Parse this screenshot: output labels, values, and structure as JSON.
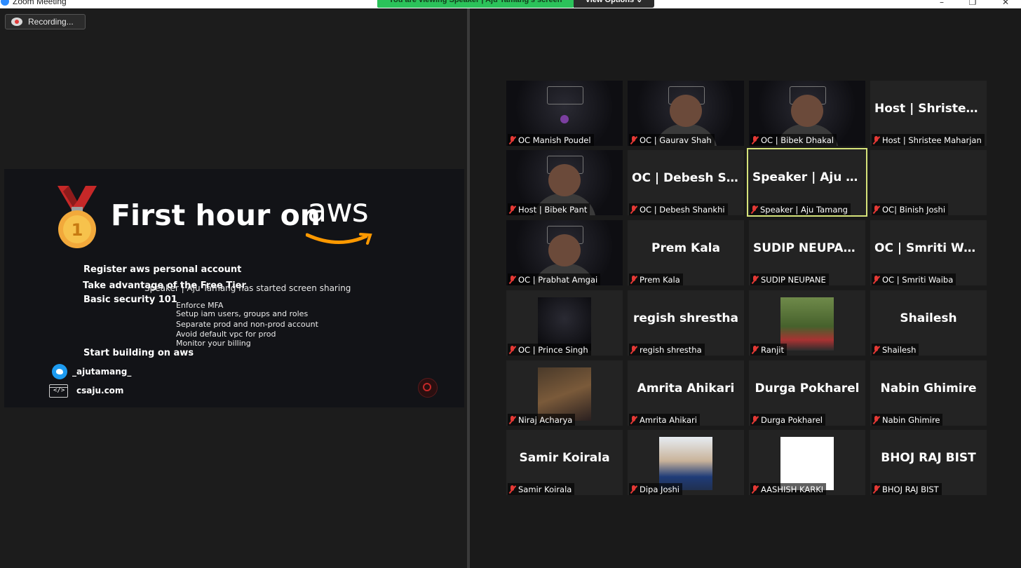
{
  "window": {
    "title": "Zoom Meeting",
    "viewing_banner": "You are viewing Speaker | Aju Tamang's screen",
    "view_options": "View Options ⌄",
    "controls": [
      "–",
      "❐",
      "✕"
    ]
  },
  "recording": {
    "label": "Recording..."
  },
  "slide": {
    "title": "First hour on",
    "brand": "aws",
    "bullets": [
      "Register aws personal account",
      "Take advantage of the Free Tier",
      "Basic security 101"
    ],
    "security_items": [
      "Enforce MFA",
      "Setup iam users, groups and roles",
      "Separate prod and non-prod account",
      "Avoid default vpc for prod",
      "Monitor your billing"
    ],
    "final_bullet": "Start building on aws",
    "twitter_handle": "_ajutamang_",
    "website": "csaju.com",
    "share_notice": "Speaker | Aju Tamang has started screen sharing",
    "medal_number": "1"
  },
  "participants": [
    {
      "label": "OC Manish Poudel",
      "name": "",
      "video": "event"
    },
    {
      "label": "OC | Gaurav Shah",
      "name": "",
      "video": "person"
    },
    {
      "label": "OC | Bibek Dhakal",
      "name": "",
      "video": "person"
    },
    {
      "label": "Host | Shristee Maharjan",
      "name": "Host | Shristee...",
      "video": "none"
    },
    {
      "label": "Host | Bibek Pant",
      "name": "",
      "video": "person"
    },
    {
      "label": "OC | Debesh Shankhi",
      "name": "OC | Debesh Sh...",
      "video": "none"
    },
    {
      "label": "Speaker | Aju Tamang",
      "name": "Speaker | Aju Ta...",
      "video": "none",
      "active": true
    },
    {
      "label": "OC| Binish Joshi",
      "name": "",
      "video": "none"
    },
    {
      "label": "OC | Prabhat Amgai",
      "name": "",
      "video": "person"
    },
    {
      "label": "Prem Kala",
      "name": "Prem Kala",
      "video": "none"
    },
    {
      "label": "SUDIP NEUPANE",
      "name": "SUDIP NEUPANE",
      "video": "none"
    },
    {
      "label": "OC | Smriti Waiba",
      "name": "OC | Smriti Waiba",
      "video": "none"
    },
    {
      "label": "OC | Prince Singh",
      "name": "",
      "video": "event-small"
    },
    {
      "label": "regish shrestha",
      "name": "regish shrestha",
      "video": "none"
    },
    {
      "label": "Ranjit",
      "name": "",
      "video": "photo-green"
    },
    {
      "label": "Shailesh",
      "name": "Shailesh",
      "video": "none"
    },
    {
      "label": "Niraj Acharya",
      "name": "",
      "video": "photo-brown"
    },
    {
      "label": "Amrita Ahikari",
      "name": "Amrita Ahikari",
      "video": "none"
    },
    {
      "label": "Durga Pokharel",
      "name": "Durga Pokharel",
      "video": "none"
    },
    {
      "label": "Nabin Ghimire",
      "name": "Nabin Ghimire",
      "video": "none"
    },
    {
      "label": "Samir Koirala",
      "name": "Samir Koirala",
      "video": "none"
    },
    {
      "label": "Dipa Joshi",
      "name": "",
      "video": "photo-blue"
    },
    {
      "label": "AASHISH KARKI",
      "name": "",
      "video": "photo-white"
    },
    {
      "label": "BHOJ RAJ BIST",
      "name": "BHOJ RAJ BIST",
      "video": "none"
    }
  ],
  "colors": {
    "active_speaker_border": "#d6e37a",
    "banner_green": "#2bc25a",
    "muted_red": "#e53935",
    "aws_orange": "#ff9900"
  }
}
